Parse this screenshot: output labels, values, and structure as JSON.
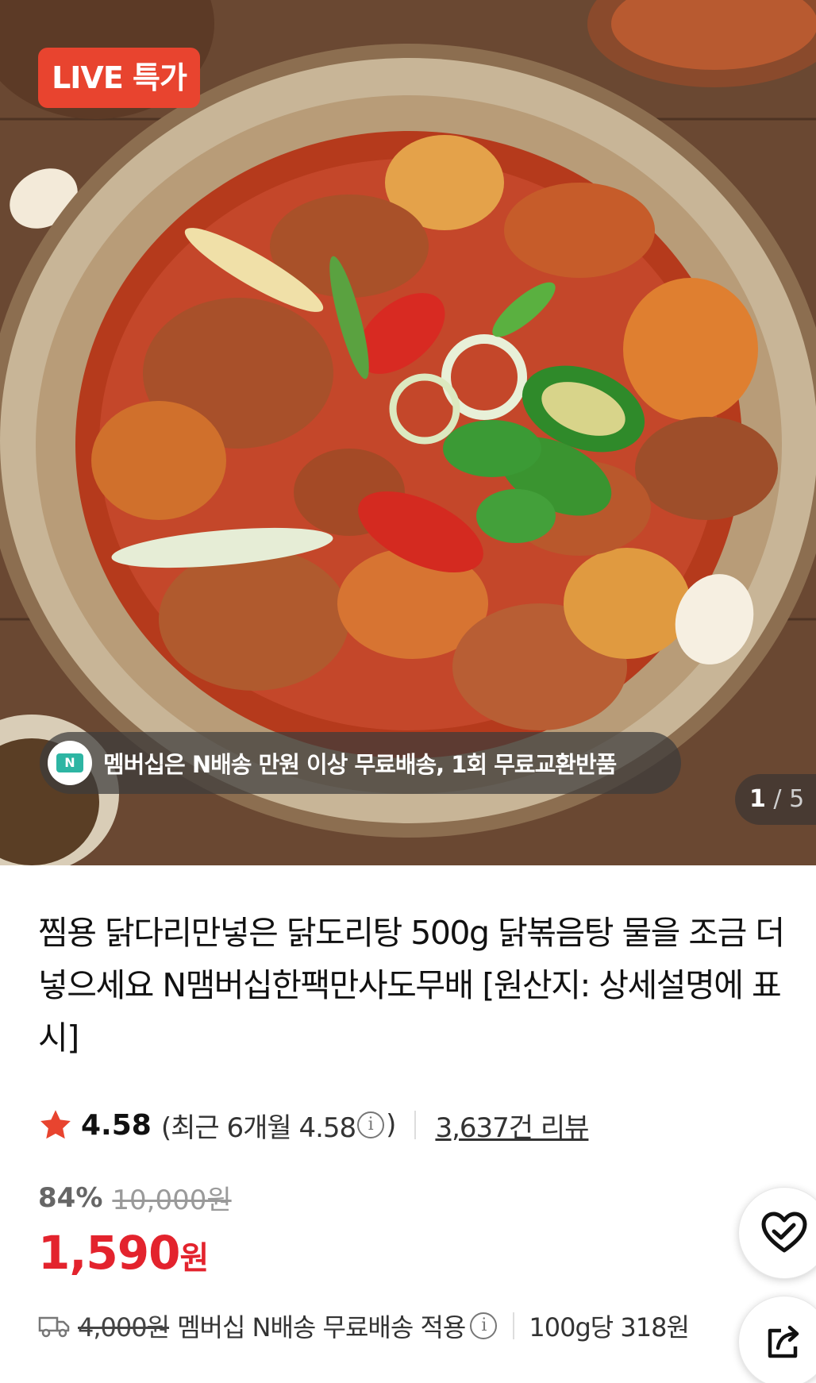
{
  "hero": {
    "badge": "LIVE 특가",
    "membership_notice": "멤버십은 N배송 만원 이상 무료배송, 1회 무료교환반품",
    "membership_icon_label": "N",
    "counter_current": "1",
    "counter_separator": "/",
    "counter_total": "5"
  },
  "product": {
    "title": "찜용 닭다리만넣은 닭도리탕 500g 닭볶음탕 물을 조금 더 넣으세요 N맴버십한팩만사도무배 [원산지: 상세설명에 표시]"
  },
  "rating": {
    "score": "4.58",
    "recent_prefix": "(최근 6개월 4.58",
    "recent_suffix": ")",
    "info_glyph": "i",
    "review_count": "3,637건 리뷰"
  },
  "price": {
    "discount_rate": "84%",
    "original": "10,000원",
    "sale_number": "1,590",
    "sale_unit": "원"
  },
  "shipping": {
    "original_fee": "4,000원",
    "notice": "멤버십 N배송 무료배송 적용",
    "info_glyph": "i",
    "unit_price": "100g당 318원"
  },
  "icons": {
    "star": "star-icon",
    "truck": "truck-icon",
    "wish": "heart-check-icon",
    "share": "share-icon"
  },
  "colors": {
    "badge_red": "#e8442f",
    "price_red": "#e3232d",
    "star_red": "#e8442f"
  }
}
